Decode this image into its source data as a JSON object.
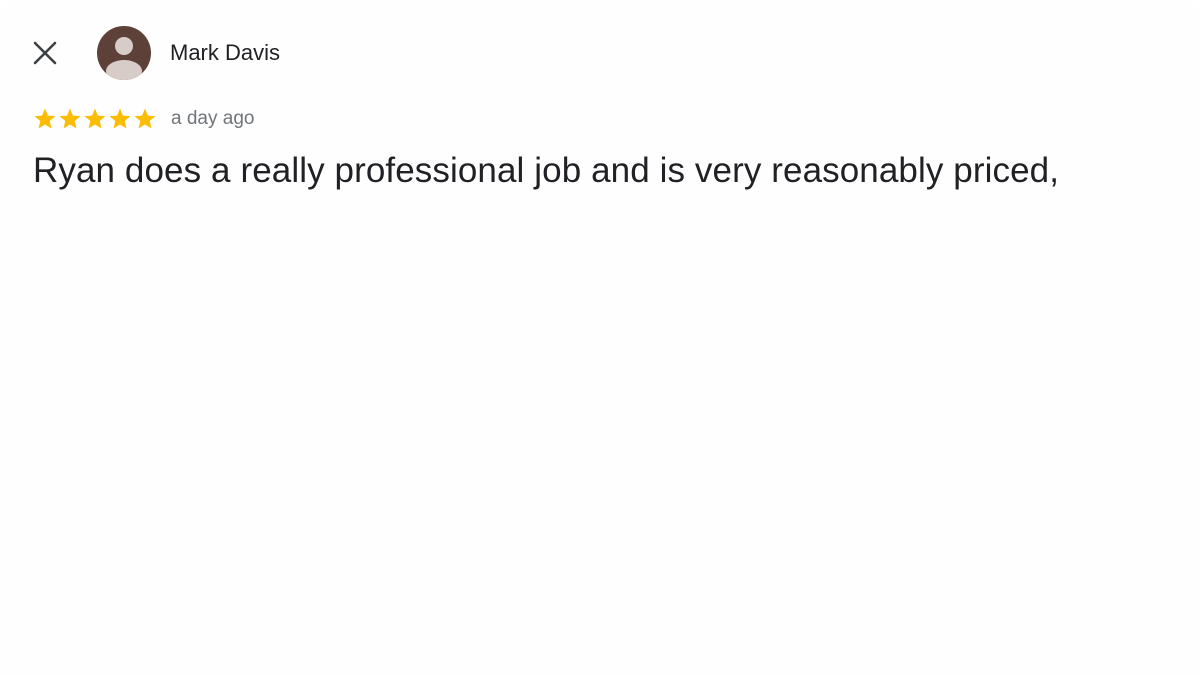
{
  "review": {
    "reviewer_name": "Mark Davis",
    "rating": 5,
    "rating_max": 5,
    "timestamp": "a day ago",
    "text": "Ryan does a really professional job and is very reasonably priced,"
  },
  "icons": {
    "close": "close-icon",
    "avatar": "person-icon",
    "star": "star-icon"
  },
  "colors": {
    "star": "#fbbc04",
    "avatar_bg": "#5d4037",
    "avatar_fg": "#d7ccc8",
    "text": "#202124",
    "muted": "#70757a"
  }
}
